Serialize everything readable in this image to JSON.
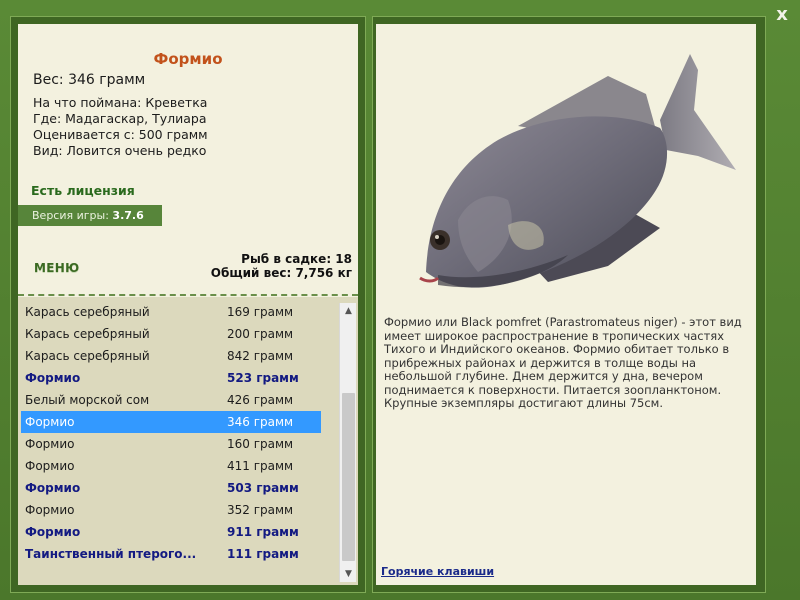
{
  "window": {
    "close_label": "x"
  },
  "fish": {
    "title": "Формио",
    "weight": "Вес: 346 грамм",
    "details": [
      "На что поймана: Креветка",
      "Где: Мадагаскар, Тулиара",
      "Оценивается с: 500 грамм",
      "Вид: Ловится очень редко"
    ],
    "description": "Формио или Black pomfret (Parastromateus niger) - этот вид имеет широкое распространение в тропических частях Тихого и Индийского океанов. Формио обитает только в прибрежных районах и держится в толще воды на небольшой глубине. Днем держится у дна, вечером поднимается к поверхности. Питается зоопланктоном. Крупные экземпляры достигают длины 75см."
  },
  "license": "Есть лицензия",
  "version": {
    "label": "Версия игры:",
    "value": "3.7.6"
  },
  "menu_label": "МЕНЮ",
  "cage": {
    "count_text": "Рыб в садке: 18",
    "total_text": "Общий вес: 7,756 кг"
  },
  "catch_list": [
    {
      "name": "Карась серебряный",
      "weight": "169 грамм",
      "bold": false,
      "selected": false
    },
    {
      "name": "Карась серебряный",
      "weight": "200 грамм",
      "bold": false,
      "selected": false
    },
    {
      "name": "Карась серебряный",
      "weight": "842 грамм",
      "bold": false,
      "selected": false
    },
    {
      "name": "Формио",
      "weight": "523 грамм",
      "bold": true,
      "selected": false
    },
    {
      "name": "Белый морской сом",
      "weight": "426 грамм",
      "bold": false,
      "selected": false
    },
    {
      "name": "Формио",
      "weight": "346 грамм",
      "bold": false,
      "selected": true
    },
    {
      "name": "Формио",
      "weight": "160 грамм",
      "bold": false,
      "selected": false
    },
    {
      "name": "Формио",
      "weight": "411 грамм",
      "bold": false,
      "selected": false
    },
    {
      "name": "Формио",
      "weight": "503 грамм",
      "bold": true,
      "selected": false
    },
    {
      "name": "Формио",
      "weight": "352 грамм",
      "bold": false,
      "selected": false
    },
    {
      "name": "Формио",
      "weight": "911 грамм",
      "bold": true,
      "selected": false
    },
    {
      "name": "Таинственный птерого...",
      "weight": "111 грамм",
      "bold": true,
      "selected": false
    }
  ],
  "hotkeys_label": "Горячие клавиши",
  "colors": {
    "frame_green": "#4e7a2e",
    "panel_bg": "#f3f1df",
    "title_orange": "#c2521b",
    "list_bold_blue": "#131a82",
    "selection_blue": "#3399ff"
  }
}
